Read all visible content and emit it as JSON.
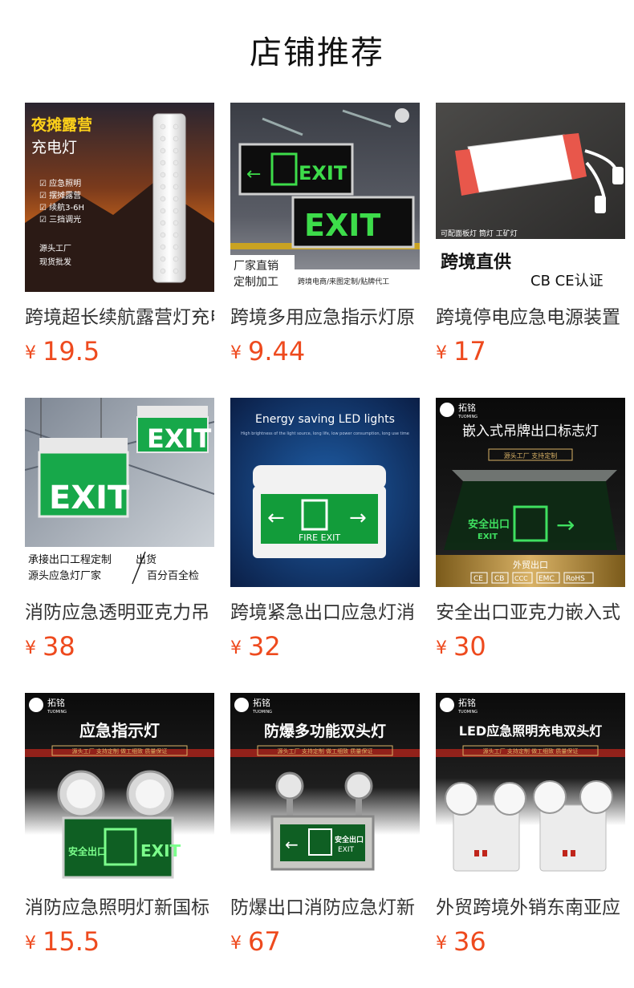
{
  "section": {
    "title": "店铺推荐"
  },
  "products": [
    {
      "name": "跨境超长续航露营灯充电",
      "currency": "¥",
      "price": "19.5",
      "thumb": {
        "headline1": "夜摊露营",
        "headline2": "充电灯",
        "features": [
          "☑ 应急照明",
          "☑ 摆摊露营",
          "☑ 续航3-6H",
          "☑ 三挡调光"
        ],
        "note1": "源头工厂",
        "note2": "现货批发"
      }
    },
    {
      "name": "跨境多用应急指示灯原",
      "currency": "¥",
      "price": "9.44",
      "thumb": {
        "sign1": "EXIT",
        "sign2": "EXIT",
        "tag1": "厂家直销",
        "tag2": "定制加工",
        "tagline": "跨境电商/来图定制/贴牌代工"
      }
    },
    {
      "name": "跨境停电应急电源装置",
      "currency": "¥",
      "price": "17",
      "thumb": {
        "caption": "可配面板灯 筒灯 工矿灯",
        "headline": "跨境直供",
        "cert": "CB CE认证"
      }
    },
    {
      "name": "消防应急透明亚克力吊",
      "currency": "¥",
      "price": "38",
      "thumb": {
        "sign1": "EXIT",
        "sign2": "EXIT",
        "line1a": "承接出口工程定制",
        "line1b": "出货",
        "line2a": "源头应急灯厂家",
        "line2b": "百分百全检"
      }
    },
    {
      "name": "跨境紧急出口应急灯消",
      "currency": "¥",
      "price": "32",
      "thumb": {
        "headline": "Energy saving LED lights",
        "subline": "High brightness of the light source, long life, low power consumption, long use time",
        "sign": "FIRE EXIT"
      }
    },
    {
      "name": "安全出口亚克力嵌入式",
      "currency": "¥",
      "price": "30",
      "thumb": {
        "brand": "拓铭",
        "brand_en": "TUOMING",
        "headline": "嵌入式吊牌出口标志灯",
        "band": "源头工厂 支持定制",
        "sign_cn": "安全出口",
        "sign_en": "EXIT",
        "export": "外贸出口",
        "certs": [
          "CE",
          "CB",
          "CCC",
          "EMC",
          "RoHS"
        ]
      }
    },
    {
      "name": "消防应急照明灯新国标",
      "currency": "¥",
      "price": "15.5",
      "thumb": {
        "brand": "拓铭",
        "brand_en": "TUOMING",
        "headline": "应急指示灯",
        "band": "源头工厂 支持定制 做工细致 质量保证",
        "sign_cn": "安全出口",
        "sign_en": "EXIT"
      }
    },
    {
      "name": "防爆出口消防应急灯新",
      "currency": "¥",
      "price": "67",
      "thumb": {
        "brand": "拓铭",
        "brand_en": "TUOMING",
        "headline": "防爆多功能双头灯",
        "band": "源头工厂 支持定制 做工细致 质量保证",
        "sign_cn": "安全出口",
        "sign_en": "EXIT"
      }
    },
    {
      "name": "外贸跨境外销东南亚应",
      "currency": "¥",
      "price": "36",
      "thumb": {
        "brand": "拓铭",
        "brand_en": "TUOMING",
        "headline": "LED应急照明充电双头灯",
        "band": "源头工厂 支持定制 做工细致 质量保证"
      }
    }
  ]
}
